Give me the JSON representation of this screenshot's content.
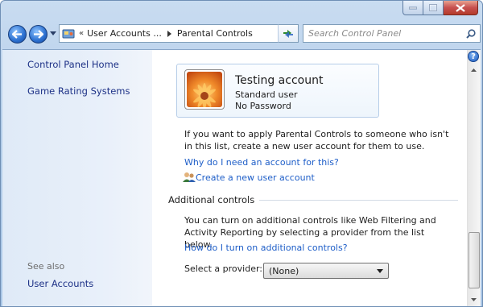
{
  "nav": {
    "crumb_overflow": "«",
    "crumbs": [
      "User Accounts ...",
      "Parental Controls"
    ],
    "search_placeholder": "Search Control Panel"
  },
  "sidebar": {
    "items": [
      {
        "label": "Control Panel Home"
      },
      {
        "label": "Game Rating Systems"
      }
    ],
    "see_also_label": "See also",
    "see_also_items": [
      {
        "label": "User Accounts"
      }
    ]
  },
  "account": {
    "name": "Testing account",
    "type": "Standard user",
    "password_status": "No Password"
  },
  "main": {
    "intro_text": "If you want to apply Parental Controls to someone who isn't in this list, create a new user account for them to use.",
    "why_link": "Why do I need an account for this?",
    "create_link": "Create a new user account",
    "additional_heading": "Additional controls",
    "additional_text": "You can turn on additional controls like Web Filtering and Activity Reporting by selecting a provider from the list below.",
    "how_link": "How do I turn on additional controls?",
    "provider_label": "Select a provider:",
    "provider_value": "(None)"
  },
  "icons": {
    "back": "back-arrow-icon",
    "forward": "forward-arrow-icon",
    "refresh": "refresh-icon",
    "search": "search-icon",
    "help": "help-icon",
    "users": "users-icon"
  },
  "colors": {
    "link": "#1e5ec8",
    "sidebar_link": "#1e3287",
    "close_button": "#c75050"
  }
}
